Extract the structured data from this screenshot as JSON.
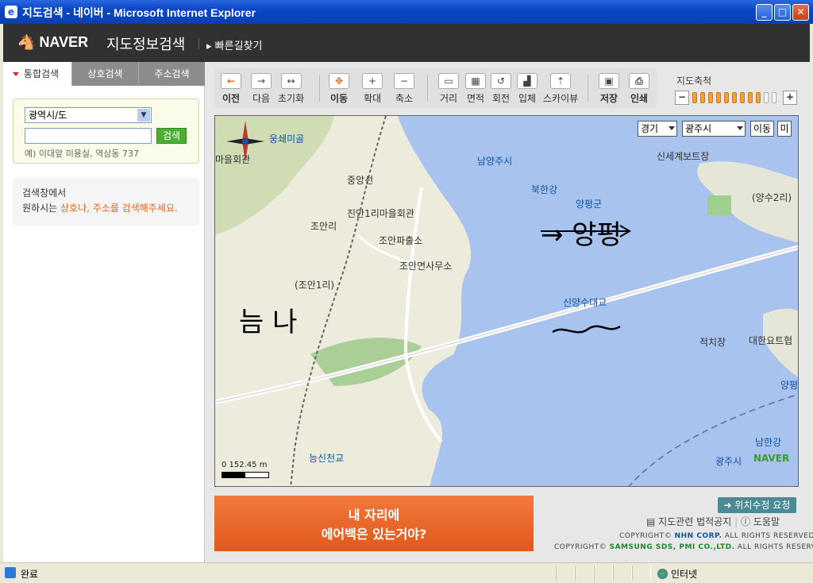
{
  "window": {
    "title": "지도검색 - 네이버 - Microsoft Internet Explorer",
    "minimize": "_",
    "maximize": "□",
    "close": "✕"
  },
  "header": {
    "logo": "NAVER",
    "service": "지도정보검색",
    "quick_link": "빠른길찾기"
  },
  "left": {
    "tabs": [
      {
        "label": "통합검색",
        "active": true
      },
      {
        "label": "상호검색",
        "active": false
      },
      {
        "label": "주소검색",
        "active": false
      }
    ],
    "search": {
      "region_select": "광역시/도",
      "input_value": "",
      "button": "검색",
      "example": "예) 이대앞 미용실, 역삼동 737"
    },
    "hint": {
      "line1": "검색창에서",
      "line2_prefix": "원하시는 ",
      "line2_highlight": "상호나, 주소를 검색해주세요."
    }
  },
  "toolbar": {
    "buttons": [
      {
        "label": "이전",
        "icon": "arrow-left-icon",
        "glyph": "←"
      },
      {
        "label": "다음",
        "icon": "arrow-right-icon",
        "glyph": "→"
      },
      {
        "label": "초기화",
        "icon": "reset-icon",
        "glyph": "↔"
      },
      {
        "label": "이동",
        "icon": "move-icon",
        "glyph": "✥"
      },
      {
        "label": "확대",
        "icon": "zoom-in-icon",
        "glyph": "+"
      },
      {
        "label": "축소",
        "icon": "zoom-out-icon",
        "glyph": "−"
      },
      {
        "label": "거리",
        "icon": "distance-icon",
        "glyph": "▭"
      },
      {
        "label": "면적",
        "icon": "area-icon",
        "glyph": "▦"
      },
      {
        "label": "회전",
        "icon": "rotate-icon",
        "glyph": "↺"
      },
      {
        "label": "입체",
        "icon": "3d-icon",
        "glyph": "▟"
      },
      {
        "label": "스카이뷰",
        "icon": "skyview-icon",
        "glyph": "⇡"
      },
      {
        "label": "저장",
        "icon": "save-icon",
        "glyph": "▣"
      },
      {
        "label": "인쇄",
        "icon": "print-icon",
        "glyph": "⎙"
      }
    ],
    "zoom": {
      "label": "지도축척",
      "minus": "−",
      "plus": "+",
      "level": 9,
      "max": 11
    }
  },
  "map": {
    "region1": "경기",
    "region2": "광주시",
    "move_button": "이동",
    "mini_button": "미",
    "labels": {
      "l1": "웅쇄미골",
      "l2": "마을회관",
      "l3": "중앙선",
      "l4": "남양주시",
      "l5": "북한강",
      "l6": "양평군",
      "l7": "신세계보트장",
      "l8": "(양수2리)",
      "l9": "진안1리마을회관",
      "l10": "조안리",
      "l11": "조안파출소",
      "l12": "조안면사무소",
      "l13": "(조안1리)",
      "l14": "신양수대교",
      "l15": "적치장",
      "l16": "대한요트협",
      "l17": "양평",
      "l18": "남한강",
      "l19": "능신천교",
      "l20": "광주시"
    },
    "handwriting": {
      "h1": "늠 나",
      "h2": "→ 양평"
    },
    "scale": "0    152.45 m",
    "logo": "NAVER"
  },
  "banner": {
    "line1": "내 자리에",
    "line2": "에어백은 있는거야?"
  },
  "footer": {
    "fix_request": "➜ 위치수정 요청",
    "legal": "지도관련 법적공지",
    "help": "도움말",
    "copy1_prefix": "COPYRIGHT© ",
    "copy1_corp": "NHN CORP.",
    "copy1_suffix": " ALL RIGHTS RESERVED.",
    "copy2_prefix": "COPYRIGHT© ",
    "copy2_corp": "SAMSUNG SDS, PMI CO.,LTD.",
    "copy2_suffix": " ALL RIGHTS RESERVED."
  },
  "status": {
    "text": "완료",
    "zone": "인터넷"
  }
}
